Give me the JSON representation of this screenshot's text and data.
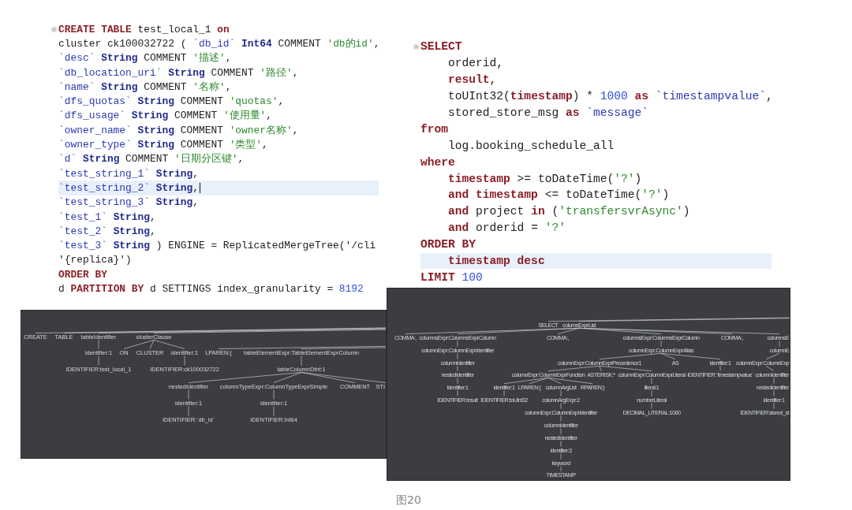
{
  "editors": [
    {
      "lines": [
        {
          "current": false,
          "cursor": false,
          "tokens": [
            {
              "text": "CREATE TABLE",
              "kind": "keyword"
            },
            {
              "text": " test_local_1 ",
              "kind": "plain"
            },
            {
              "text": "on",
              "kind": "keyword"
            }
          ]
        },
        {
          "current": false,
          "cursor": false,
          "tokens": [
            {
              "text": "cluster ck100032722 ( ",
              "kind": "plain"
            },
            {
              "text": "`db_id` ",
              "kind": "identifier"
            },
            {
              "text": "Int64",
              "kind": "type"
            },
            {
              "text": " COMMENT ",
              "kind": "plain"
            },
            {
              "text": "'db的id'",
              "kind": "string"
            },
            {
              "text": ",",
              "kind": "plain"
            }
          ]
        },
        {
          "current": false,
          "cursor": false,
          "tokens": [
            {
              "text": "`desc` ",
              "kind": "identifier"
            },
            {
              "text": "String",
              "kind": "type"
            },
            {
              "text": " COMMENT ",
              "kind": "plain"
            },
            {
              "text": "'描述'",
              "kind": "string"
            },
            {
              "text": ",",
              "kind": "plain"
            }
          ]
        },
        {
          "current": false,
          "cursor": false,
          "tokens": [
            {
              "text": "`db_location_uri` ",
              "kind": "identifier"
            },
            {
              "text": "String",
              "kind": "type"
            },
            {
              "text": " COMMENT ",
              "kind": "plain"
            },
            {
              "text": "'路径'",
              "kind": "string"
            },
            {
              "text": ",",
              "kind": "plain"
            }
          ]
        },
        {
          "current": false,
          "cursor": false,
          "tokens": [
            {
              "text": "`name` ",
              "kind": "identifier"
            },
            {
              "text": "String",
              "kind": "type"
            },
            {
              "text": " COMMENT ",
              "kind": "plain"
            },
            {
              "text": "'名称'",
              "kind": "string"
            },
            {
              "text": ",",
              "kind": "plain"
            }
          ]
        },
        {
          "current": false,
          "cursor": false,
          "tokens": [
            {
              "text": "`dfs_quotas` ",
              "kind": "identifier"
            },
            {
              "text": "String",
              "kind": "type"
            },
            {
              "text": " COMMENT ",
              "kind": "plain"
            },
            {
              "text": "'quotas'",
              "kind": "string"
            },
            {
              "text": ",",
              "kind": "plain"
            }
          ]
        },
        {
          "current": false,
          "cursor": false,
          "tokens": [
            {
              "text": "`dfs_usage` ",
              "kind": "identifier"
            },
            {
              "text": "String",
              "kind": "type"
            },
            {
              "text": " COMMENT ",
              "kind": "plain"
            },
            {
              "text": "'使用量'",
              "kind": "string"
            },
            {
              "text": ",",
              "kind": "plain"
            }
          ]
        },
        {
          "current": false,
          "cursor": false,
          "tokens": [
            {
              "text": "`owner_name` ",
              "kind": "identifier"
            },
            {
              "text": "String",
              "kind": "type"
            },
            {
              "text": " COMMENT ",
              "kind": "plain"
            },
            {
              "text": "'owner名称'",
              "kind": "string"
            },
            {
              "text": ",",
              "kind": "plain"
            }
          ]
        },
        {
          "current": false,
          "cursor": false,
          "tokens": [
            {
              "text": "`owner_type` ",
              "kind": "identifier"
            },
            {
              "text": "String",
              "kind": "type"
            },
            {
              "text": " COMMENT ",
              "kind": "plain"
            },
            {
              "text": "'类型'",
              "kind": "string"
            },
            {
              "text": ",",
              "kind": "plain"
            }
          ]
        },
        {
          "current": false,
          "cursor": false,
          "tokens": [
            {
              "text": "`d` ",
              "kind": "identifier"
            },
            {
              "text": "String",
              "kind": "type"
            },
            {
              "text": " COMMENT ",
              "kind": "plain"
            },
            {
              "text": "'日期分区键'",
              "kind": "string"
            },
            {
              "text": ",",
              "kind": "plain"
            }
          ]
        },
        {
          "current": false,
          "cursor": false,
          "tokens": [
            {
              "text": "`test_string_1` ",
              "kind": "identifier"
            },
            {
              "text": "String",
              "kind": "type"
            },
            {
              "text": ",",
              "kind": "plain"
            }
          ]
        },
        {
          "current": true,
          "cursor": true,
          "tokens": [
            {
              "text": "`test_string_2` ",
              "kind": "identifier"
            },
            {
              "text": "String",
              "kind": "type"
            },
            {
              "text": ",",
              "kind": "plain"
            }
          ]
        },
        {
          "current": false,
          "cursor": false,
          "tokens": [
            {
              "text": "`test_string_3` ",
              "kind": "identifier"
            },
            {
              "text": "String",
              "kind": "type"
            },
            {
              "text": ",",
              "kind": "plain"
            }
          ]
        },
        {
          "current": false,
          "cursor": false,
          "tokens": [
            {
              "text": "`test_1` ",
              "kind": "identifier"
            },
            {
              "text": "String",
              "kind": "type"
            },
            {
              "text": ",",
              "kind": "plain"
            }
          ]
        },
        {
          "current": false,
          "cursor": false,
          "tokens": [
            {
              "text": "`test_2` ",
              "kind": "identifier"
            },
            {
              "text": "String",
              "kind": "type"
            },
            {
              "text": ",",
              "kind": "plain"
            }
          ]
        },
        {
          "current": false,
          "cursor": false,
          "tokens": [
            {
              "text": "`test_3` ",
              "kind": "identifier"
            },
            {
              "text": "String",
              "kind": "type"
            },
            {
              "text": " ) ENGINE = ReplicatedMergeTree('/cli",
              "kind": "plain"
            }
          ]
        },
        {
          "current": false,
          "cursor": false,
          "tokens": [
            {
              "text": "'{replica}')",
              "kind": "plain"
            }
          ]
        },
        {
          "current": false,
          "cursor": false,
          "tokens": [
            {
              "text": "ORDER BY",
              "kind": "keyword"
            }
          ]
        },
        {
          "current": false,
          "cursor": false,
          "tokens": [
            {
              "text": "d ",
              "kind": "plain"
            },
            {
              "text": "PARTITION BY",
              "kind": "keyword"
            },
            {
              "text": " d SETTINGS index_granularity = ",
              "kind": "plain"
            },
            {
              "text": "8192",
              "kind": "number"
            }
          ]
        }
      ]
    },
    {
      "lines": [
        {
          "current": false,
          "cursor": false,
          "tokens": [
            {
              "text": "SELECT",
              "kind": "keyword"
            }
          ]
        },
        {
          "current": false,
          "cursor": false,
          "tokens": [
            {
              "text": "    orderid,",
              "kind": "plain"
            }
          ]
        },
        {
          "current": false,
          "cursor": false,
          "tokens": [
            {
              "text": "    result",
              "kind": "keyword"
            },
            {
              "text": ",",
              "kind": "plain"
            }
          ]
        },
        {
          "current": false,
          "cursor": false,
          "tokens": [
            {
              "text": "    toUInt32(",
              "kind": "plain"
            },
            {
              "text": "timestamp",
              "kind": "keyword"
            },
            {
              "text": ") * ",
              "kind": "plain"
            },
            {
              "text": "1000 ",
              "kind": "number"
            },
            {
              "text": "as ",
              "kind": "keyword"
            },
            {
              "text": "`timestampvalue`",
              "kind": "identifier"
            },
            {
              "text": ",",
              "kind": "plain"
            }
          ]
        },
        {
          "current": false,
          "cursor": false,
          "tokens": [
            {
              "text": "    stored_store_msg ",
              "kind": "plain"
            },
            {
              "text": "as ",
              "kind": "keyword"
            },
            {
              "text": "`message`",
              "kind": "identifier"
            }
          ]
        },
        {
          "current": false,
          "cursor": false,
          "tokens": [
            {
              "text": "from",
              "kind": "keyword"
            }
          ]
        },
        {
          "current": false,
          "cursor": false,
          "tokens": [
            {
              "text": "    log.booking_schedule_all",
              "kind": "plain"
            }
          ]
        },
        {
          "current": false,
          "cursor": false,
          "tokens": [
            {
              "text": "where",
              "kind": "keyword"
            }
          ]
        },
        {
          "current": false,
          "cursor": false,
          "tokens": [
            {
              "text": "    timestamp",
              "kind": "keyword"
            },
            {
              "text": " >= toDateTime(",
              "kind": "plain"
            },
            {
              "text": "'?'",
              "kind": "string"
            },
            {
              "text": ")",
              "kind": "plain"
            }
          ]
        },
        {
          "current": false,
          "cursor": false,
          "tokens": [
            {
              "text": "    and timestamp",
              "kind": "keyword"
            },
            {
              "text": " <= toDateTime(",
              "kind": "plain"
            },
            {
              "text": "'?'",
              "kind": "string"
            },
            {
              "text": ")",
              "kind": "plain"
            }
          ]
        },
        {
          "current": false,
          "cursor": false,
          "tokens": [
            {
              "text": "    and",
              "kind": "keyword"
            },
            {
              "text": " project ",
              "kind": "plain"
            },
            {
              "text": "in",
              "kind": "keyword"
            },
            {
              "text": " (",
              "kind": "plain"
            },
            {
              "text": "'transfersvrAsync'",
              "kind": "string"
            },
            {
              "text": ")",
              "kind": "plain"
            }
          ]
        },
        {
          "current": false,
          "cursor": false,
          "tokens": [
            {
              "text": "    and",
              "kind": "keyword"
            },
            {
              "text": " orderid = ",
              "kind": "plain"
            },
            {
              "text": "'?'",
              "kind": "string"
            }
          ]
        },
        {
          "current": false,
          "cursor": false,
          "tokens": [
            {
              "text": "ORDER BY",
              "kind": "keyword"
            }
          ]
        },
        {
          "current": true,
          "cursor": false,
          "tokens": [
            {
              "text": "    timestamp desc",
              "kind": "keyword"
            }
          ]
        },
        {
          "current": false,
          "cursor": false,
          "tokens": [
            {
              "text": "LIMIT",
              "kind": "keyword"
            },
            {
              "text": " 100",
              "kind": "number"
            }
          ]
        }
      ]
    }
  ],
  "parse_trees": [
    {
      "nodes": [
        {
          "label": "CREATE"
        },
        {
          "label": "TABLE"
        },
        {
          "label": "tableIdentifier",
          "children": [
            {
              "label": "identifier:1",
              "children": [
                {
                  "label": "IDENTIFIER:test_local_1"
                }
              ]
            }
          ]
        },
        {
          "label": "clusterClause",
          "children": [
            {
              "label": "ON"
            },
            {
              "label": "CLUSTER"
            },
            {
              "label": "identifier:1",
              "children": [
                {
                  "label": "IDENTIFIER:ck100032722"
                }
              ]
            }
          ]
        },
        {
          "label": "LPAREN:("
        },
        {
          "label": "tableElementExpr:TableElementExprColumn",
          "children": [
            {
              "label": "tableColumnDfnt:1",
              "children": [
                {
                  "label": "nestedIdentifier",
                  "children": [
                    {
                      "label": "identifier:1",
                      "children": [
                        {
                          "label": "IDENTIFIER:`db_id`"
                        }
                      ]
                    }
                  ]
                },
                {
                  "label": "columnTypeExpr:ColumnTypeExprSimple",
                  "children": [
                    {
                      "label": "identifier:1",
                      "children": [
                        {
                          "label": "IDENTIFIER:Int64"
                        }
                      ]
                    }
                  ]
                },
                {
                  "label": "COMMENT"
                },
                {
                  "label": "STI"
                }
              ]
            }
          ]
        }
      ]
    },
    {
      "nodes": [
        {
          "label": "SELECT"
        },
        {
          "label": "columnExprList",
          "children": [
            {
              "label": "COMMA:,"
            },
            {
              "label": "columnsExpr:ColumnsExprColumn",
              "children": [
                {
                  "label": "columnExpr:ColumnExprIdentifier",
                  "children": [
                    {
                      "label": "columnIdentifier",
                      "children": [
                        {
                          "label": "nestedIdentifier",
                          "children": [
                            {
                              "label": "identifier:1",
                              "children": [
                                {
                                  "label": "IDENTIFIER:result"
                                }
                              ]
                            }
                          ]
                        }
                      ]
                    }
                  ]
                }
              ]
            },
            {
              "label": "COMMA:,"
            },
            {
              "label": "columnsExpr:ColumnsExprColumn",
              "children": [
                {
                  "label": "columnExpr:ColumnExprAlias",
                  "children": [
                    {
                      "label": "columnExpr:ColumnExprPrecedence1",
                      "children": [
                        {
                          "label": "columnExpr:ColumnExprFunction",
                          "children": [
                            {
                              "label": "identifier:1",
                              "children": [
                                {
                                  "label": "IDENTIFIER:toUInt32"
                                }
                              ]
                            },
                            {
                              "label": "LPAREN:("
                            },
                            {
                              "label": "columnArgList",
                              "children": [
                                {
                                  "label": "columnArgExpr:2",
                                  "children": [
                                    {
                                      "label": "columnExpr:ColumnExprIdentifier",
                                      "children": [
                                        {
                                          "label": "columnIdentifier",
                                          "children": [
                                            {
                                              "label": "nestedIdentifier",
                                              "children": [
                                                {
                                                  "label": "identifier:3",
                                                  "children": [
                                                    {
                                                      "label": "keyword",
                                                      "children": [
                                                        {
                                                          "label": "TIMESTAMP"
                                                        }
                                                      ]
                                                    }
                                                  ]
                                                }
                                              ]
                                            }
                                          ]
                                        }
                                      ]
                                    }
                                  ]
                                }
                              ]
                            },
                            {
                              "label": "RPAREN:)"
                            }
                          ]
                        },
                        {
                          "label": "ASTERISK:*"
                        },
                        {
                          "label": "columnExpr:ColumnExprLiteral",
                          "children": [
                            {
                              "label": "literal:1",
                              "children": [
                                {
                                  "label": "numberLiteral",
                                  "children": [
                                    {
                                      "label": "DECIMAL_LITERAL:1000"
                                    }
                                  ]
                                }
                              ]
                            }
                          ]
                        }
                      ]
                    },
                    {
                      "label": "AS"
                    },
                    {
                      "label": "identifier:1",
                      "children": [
                        {
                          "label": "IDENTIFIER:`timestampvalue`"
                        }
                      ]
                    }
                  ]
                }
              ]
            },
            {
              "label": "COMMA:,"
            },
            {
              "label": "columnsE",
              "children": [
                {
                  "label": "columnE",
                  "children": [
                    {
                      "label": "columnExpr:ColumnExp",
                      "children": [
                        {
                          "label": "columnIdentifier",
                          "children": [
                            {
                              "label": "nestedIdentifier",
                              "children": [
                                {
                                  "label": "identifier:1",
                                  "children": [
                                    {
                                      "label": "IDENTIFIER:stored_st"
                                    }
                                  ]
                                }
                              ]
                            }
                          ]
                        }
                      ]
                    }
                  ]
                }
              ]
            }
          ]
        }
      ]
    }
  ],
  "caption": "图20"
}
